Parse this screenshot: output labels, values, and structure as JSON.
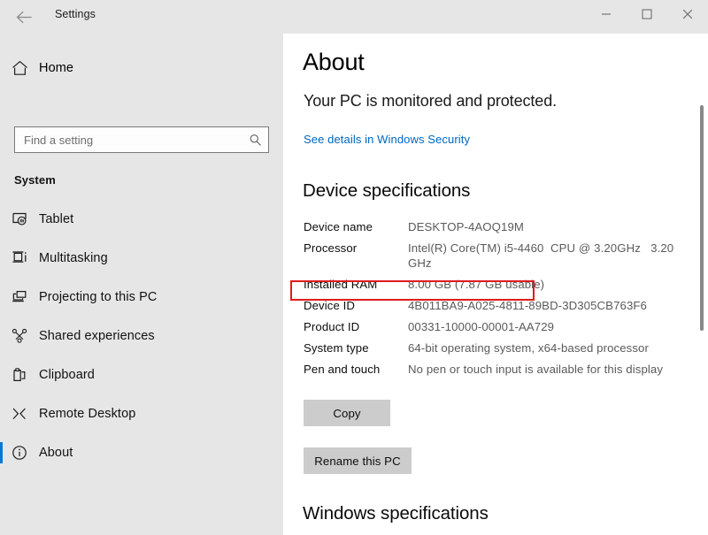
{
  "window": {
    "app_title": "Settings",
    "back_icon": "back-arrow-icon",
    "controls": {
      "minimize_label": "Minimize",
      "maximize_label": "Maximize",
      "close_label": "Close"
    }
  },
  "sidebar": {
    "home": {
      "label": "Home",
      "icon": "home-icon"
    },
    "search": {
      "value": "",
      "placeholder": "Find a setting",
      "icon": "search-icon"
    },
    "group_title": "System",
    "items": [
      {
        "label": "Tablet",
        "icon": "tablet-icon",
        "selected": false
      },
      {
        "label": "Multitasking",
        "icon": "multitasking-icon",
        "selected": false
      },
      {
        "label": "Projecting to this PC",
        "icon": "projecting-icon",
        "selected": false
      },
      {
        "label": "Shared experiences",
        "icon": "shared-experiences-icon",
        "selected": false
      },
      {
        "label": "Clipboard",
        "icon": "clipboard-icon",
        "selected": false
      },
      {
        "label": "Remote Desktop",
        "icon": "remote-desktop-icon",
        "selected": false
      },
      {
        "label": "About",
        "icon": "info-icon",
        "selected": true
      }
    ],
    "accent_color": "#0078d7",
    "background_color": "#e6e6e6"
  },
  "main": {
    "page_title": "About",
    "security_status": "Your PC is monitored and protected.",
    "security_link": "See details in Windows Security",
    "device_specifications_heading": "Device specifications",
    "specs": [
      {
        "key": "Device name",
        "value": "DESKTOP-4AOQ19M"
      },
      {
        "key": "Processor",
        "value": "Intel(R) Core(TM) i5-4460  CPU @ 3.20GHz   3.20 GHz"
      },
      {
        "key": "Installed RAM",
        "value": "8.00 GB (7.87 GB usable)"
      },
      {
        "key": "Device ID",
        "value": "4B011BA9-A025-4811-89BD-3D305CB763F6"
      },
      {
        "key": "Product ID",
        "value": "00331-10000-00001-AA729"
      },
      {
        "key": "System type",
        "value": "64-bit operating system, x64-based processor"
      },
      {
        "key": "Pen and touch",
        "value": "No pen or touch input is available for this display"
      }
    ],
    "copy_button": "Copy",
    "rename_button": "Rename this PC",
    "windows_specifications_heading": "Windows specifications",
    "link_color": "#0067c0",
    "annotation_color": "#e01b1b",
    "annotated_row_key": "Installed RAM"
  }
}
